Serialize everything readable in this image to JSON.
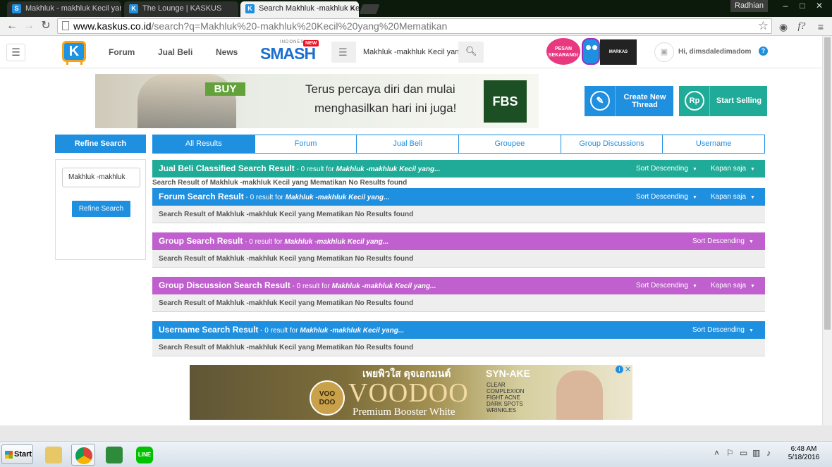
{
  "browser": {
    "tabs": [
      {
        "title": "Makhluk - makhluk Kecil yan",
        "favicon": "kaskus-icon",
        "active": false
      },
      {
        "title": "The Lounge | KASKUS",
        "favicon": "kaskus-icon",
        "active": false
      },
      {
        "title": "Search Makhluk -makhluk Ke",
        "favicon": "kaskus-icon",
        "active": true
      }
    ],
    "profile_name": "Radhian",
    "url_host": "www.kaskus.co.id",
    "url_path": "/search?q=Makhluk%20-makhluk%20Kecil%20yang%20Mematikan"
  },
  "header": {
    "nav": [
      "Forum",
      "Jual Beli",
      "News"
    ],
    "smash_small": "INDONESIA",
    "smash_word": "SMASH",
    "smash_new": "NEW",
    "search_value": "Makhluk -makhluk Kecil yan",
    "promo_text": "PESAN SEKARANG!",
    "gamefest_text": "MARKAS",
    "greeting": "Hi, dimsdaledimadom",
    "help": "?"
  },
  "banner_ad": {
    "buy": "BUY",
    "line1": "Terus percaya diri dan mulai",
    "line2": "menghasilkan hari ini juga!",
    "brand": "FBS"
  },
  "actions": {
    "create_thread": "Create New Thread",
    "start_selling": "Start Selling",
    "rp_icon": "Rp"
  },
  "sidebar": {
    "title": "Refine Search",
    "input_value": "Makhluk -makhluk",
    "button": "Refine Search"
  },
  "result_tabs": [
    "All Results",
    "Forum",
    "Jual Beli",
    "Groupee",
    "Group Discussions",
    "Username"
  ],
  "sections": [
    {
      "title": "Jual Beli Classified Search Result",
      "count": " - 0 result for ",
      "query": "Makhluk -makhluk Kecil yang...",
      "sort": "Sort Descending",
      "time": "Kapan saja",
      "color": "#1fab97",
      "message": "Search Result of Makhluk -makhluk Kecil yang Mematikan No Results found"
    },
    {
      "title": "Forum Search Result",
      "count": " - 0 result for ",
      "query": "Makhluk -makhluk Kecil yang...",
      "sort": "Sort Descending",
      "time": "Kapan saja",
      "color": "#1f8fe0",
      "message": "Search Result of Makhluk -makhluk Kecil yang Mematikan No Results found"
    },
    {
      "title": "Group Search Result",
      "count": " - 0 result for ",
      "query": "Makhluk -makhluk Kecil yang...",
      "sort": "Sort Descending",
      "time": "",
      "color": "#c05fce",
      "message": "Search Result of Makhluk -makhluk Kecil yang Mematikan No Results found"
    },
    {
      "title": "Group Discussion Search Result",
      "count": " - 0 result for ",
      "query": "Makhluk -makhluk Kecil yang...",
      "sort": "Sort Descending",
      "time": "Kapan saja",
      "color": "#c05fce",
      "message": "Search Result of Makhluk -makhluk Kecil yang Mematikan No Results found"
    },
    {
      "title": "Username Search Result",
      "count": " - 0 result for ",
      "query": "Makhluk -makhluk Kecil yang...",
      "sort": "Sort Descending",
      "time": "",
      "color": "#1f8fe0",
      "message": "Search Result of Makhluk -makhluk Kecil yang Mematikan No Results found"
    }
  ],
  "bottom_ad": {
    "thai_text": "เพยพิวใส ดุจเอกมนต์",
    "syn": "SYN-AKE",
    "seal": "VOO DOO",
    "brand": "VOODOO",
    "tagline": "Premium Booster White",
    "claims": "CLEAR COMPLEXION FIGHT ACNE DARK SPOTS WRINKLES"
  },
  "taskbar": {
    "start": "Start",
    "apps": [
      "file-explorer-icon",
      "chrome-icon",
      "app-icon",
      "line-icon"
    ],
    "line_label": "LINE",
    "time": "6:48 AM",
    "date": "5/18/2016"
  }
}
